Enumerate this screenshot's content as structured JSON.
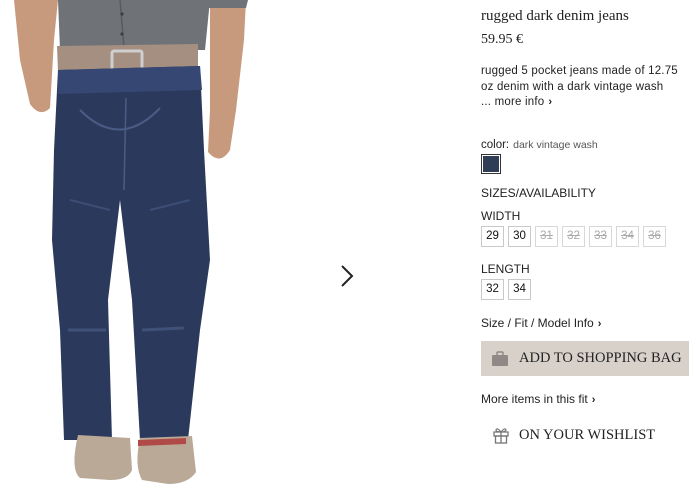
{
  "product": {
    "title": "rugged dark denim jeans",
    "price": "59.95 €",
    "description": "rugged 5 pocket jeans made of 12.75 oz denim with a dark vintage wash",
    "more_info": "... more info",
    "image_icon": "jeans-model-photo"
  },
  "color": {
    "label": "color:",
    "value": "dark vintage wash",
    "swatch_color": "#2f3e56"
  },
  "sizes": {
    "heading": "SIZES/AVAILABILITY",
    "width_label": "WIDTH",
    "widths": [
      {
        "label": "29",
        "available": true
      },
      {
        "label": "30",
        "available": true
      },
      {
        "label": "31",
        "available": false
      },
      {
        "label": "32",
        "available": false
      },
      {
        "label": "33",
        "available": false
      },
      {
        "label": "34",
        "available": false
      },
      {
        "label": "36",
        "available": false
      }
    ],
    "length_label": "LENGTH",
    "lengths": [
      {
        "label": "32",
        "available": true
      },
      {
        "label": "34",
        "available": true
      }
    ]
  },
  "links": {
    "size_fit": "Size / Fit / Model Info",
    "more_fit": "More items in this fit"
  },
  "actions": {
    "add_to_bag": "ADD TO SHOPPING BAG",
    "wishlist": "ON YOUR WISHLIST",
    "button_color": "#d8d1c9"
  }
}
